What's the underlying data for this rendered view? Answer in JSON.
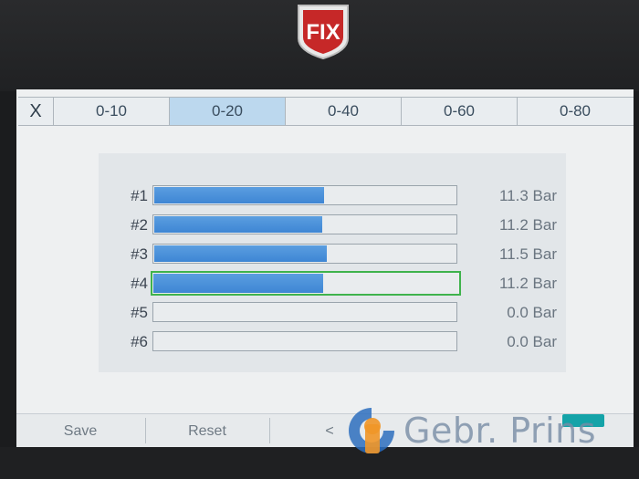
{
  "device": {
    "brand_logo_text": "FIX"
  },
  "tabs": [
    {
      "label": "X"
    },
    {
      "label": "0-10"
    },
    {
      "label": "0-20",
      "active": true
    },
    {
      "label": "0-40"
    },
    {
      "label": "0-60"
    },
    {
      "label": "0-80"
    }
  ],
  "gauge": {
    "range_max": 20,
    "selected_row": 4,
    "rows": [
      {
        "label": "#1",
        "value_text": "11.3 Bar",
        "value": 11.3
      },
      {
        "label": "#2",
        "value_text": "11.2 Bar",
        "value": 11.2
      },
      {
        "label": "#3",
        "value_text": "11.5 Bar",
        "value": 11.5
      },
      {
        "label": "#4",
        "value_text": "11.2 Bar",
        "value": 11.2
      },
      {
        "label": "#5",
        "value_text": "0.0 Bar",
        "value": 0.0
      },
      {
        "label": "#6",
        "value_text": "0.0 Bar",
        "value": 0.0
      }
    ]
  },
  "bottom_bar": {
    "save": "Save",
    "reset": "Reset",
    "prev": "<"
  },
  "watermark": {
    "text": "Gebr. Prins"
  },
  "colors": {
    "fill": "#3e86d4",
    "selected_border": "#3fb34c",
    "active_tab": "#bcd8ee"
  }
}
